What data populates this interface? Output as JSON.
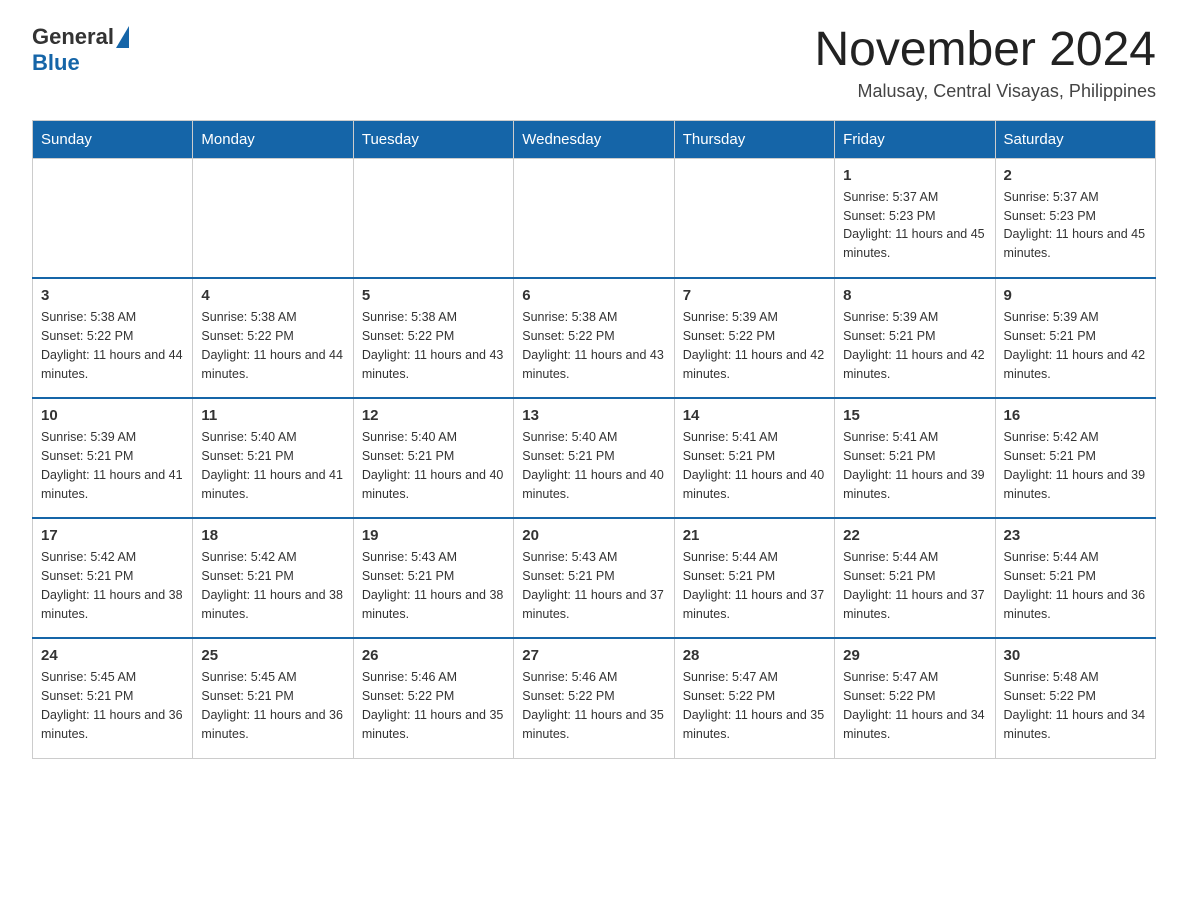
{
  "header": {
    "logo_general": "General",
    "logo_blue": "Blue",
    "month_title": "November 2024",
    "location": "Malusay, Central Visayas, Philippines"
  },
  "weekdays": [
    "Sunday",
    "Monday",
    "Tuesday",
    "Wednesday",
    "Thursday",
    "Friday",
    "Saturday"
  ],
  "weeks": [
    [
      {
        "day": "",
        "info": ""
      },
      {
        "day": "",
        "info": ""
      },
      {
        "day": "",
        "info": ""
      },
      {
        "day": "",
        "info": ""
      },
      {
        "day": "",
        "info": ""
      },
      {
        "day": "1",
        "info": "Sunrise: 5:37 AM\nSunset: 5:23 PM\nDaylight: 11 hours and 45 minutes."
      },
      {
        "day": "2",
        "info": "Sunrise: 5:37 AM\nSunset: 5:23 PM\nDaylight: 11 hours and 45 minutes."
      }
    ],
    [
      {
        "day": "3",
        "info": "Sunrise: 5:38 AM\nSunset: 5:22 PM\nDaylight: 11 hours and 44 minutes."
      },
      {
        "day": "4",
        "info": "Sunrise: 5:38 AM\nSunset: 5:22 PM\nDaylight: 11 hours and 44 minutes."
      },
      {
        "day": "5",
        "info": "Sunrise: 5:38 AM\nSunset: 5:22 PM\nDaylight: 11 hours and 43 minutes."
      },
      {
        "day": "6",
        "info": "Sunrise: 5:38 AM\nSunset: 5:22 PM\nDaylight: 11 hours and 43 minutes."
      },
      {
        "day": "7",
        "info": "Sunrise: 5:39 AM\nSunset: 5:22 PM\nDaylight: 11 hours and 42 minutes."
      },
      {
        "day": "8",
        "info": "Sunrise: 5:39 AM\nSunset: 5:21 PM\nDaylight: 11 hours and 42 minutes."
      },
      {
        "day": "9",
        "info": "Sunrise: 5:39 AM\nSunset: 5:21 PM\nDaylight: 11 hours and 42 minutes."
      }
    ],
    [
      {
        "day": "10",
        "info": "Sunrise: 5:39 AM\nSunset: 5:21 PM\nDaylight: 11 hours and 41 minutes."
      },
      {
        "day": "11",
        "info": "Sunrise: 5:40 AM\nSunset: 5:21 PM\nDaylight: 11 hours and 41 minutes."
      },
      {
        "day": "12",
        "info": "Sunrise: 5:40 AM\nSunset: 5:21 PM\nDaylight: 11 hours and 40 minutes."
      },
      {
        "day": "13",
        "info": "Sunrise: 5:40 AM\nSunset: 5:21 PM\nDaylight: 11 hours and 40 minutes."
      },
      {
        "day": "14",
        "info": "Sunrise: 5:41 AM\nSunset: 5:21 PM\nDaylight: 11 hours and 40 minutes."
      },
      {
        "day": "15",
        "info": "Sunrise: 5:41 AM\nSunset: 5:21 PM\nDaylight: 11 hours and 39 minutes."
      },
      {
        "day": "16",
        "info": "Sunrise: 5:42 AM\nSunset: 5:21 PM\nDaylight: 11 hours and 39 minutes."
      }
    ],
    [
      {
        "day": "17",
        "info": "Sunrise: 5:42 AM\nSunset: 5:21 PM\nDaylight: 11 hours and 38 minutes."
      },
      {
        "day": "18",
        "info": "Sunrise: 5:42 AM\nSunset: 5:21 PM\nDaylight: 11 hours and 38 minutes."
      },
      {
        "day": "19",
        "info": "Sunrise: 5:43 AM\nSunset: 5:21 PM\nDaylight: 11 hours and 38 minutes."
      },
      {
        "day": "20",
        "info": "Sunrise: 5:43 AM\nSunset: 5:21 PM\nDaylight: 11 hours and 37 minutes."
      },
      {
        "day": "21",
        "info": "Sunrise: 5:44 AM\nSunset: 5:21 PM\nDaylight: 11 hours and 37 minutes."
      },
      {
        "day": "22",
        "info": "Sunrise: 5:44 AM\nSunset: 5:21 PM\nDaylight: 11 hours and 37 minutes."
      },
      {
        "day": "23",
        "info": "Sunrise: 5:44 AM\nSunset: 5:21 PM\nDaylight: 11 hours and 36 minutes."
      }
    ],
    [
      {
        "day": "24",
        "info": "Sunrise: 5:45 AM\nSunset: 5:21 PM\nDaylight: 11 hours and 36 minutes."
      },
      {
        "day": "25",
        "info": "Sunrise: 5:45 AM\nSunset: 5:21 PM\nDaylight: 11 hours and 36 minutes."
      },
      {
        "day": "26",
        "info": "Sunrise: 5:46 AM\nSunset: 5:22 PM\nDaylight: 11 hours and 35 minutes."
      },
      {
        "day": "27",
        "info": "Sunrise: 5:46 AM\nSunset: 5:22 PM\nDaylight: 11 hours and 35 minutes."
      },
      {
        "day": "28",
        "info": "Sunrise: 5:47 AM\nSunset: 5:22 PM\nDaylight: 11 hours and 35 minutes."
      },
      {
        "day": "29",
        "info": "Sunrise: 5:47 AM\nSunset: 5:22 PM\nDaylight: 11 hours and 34 minutes."
      },
      {
        "day": "30",
        "info": "Sunrise: 5:48 AM\nSunset: 5:22 PM\nDaylight: 11 hours and 34 minutes."
      }
    ]
  ]
}
